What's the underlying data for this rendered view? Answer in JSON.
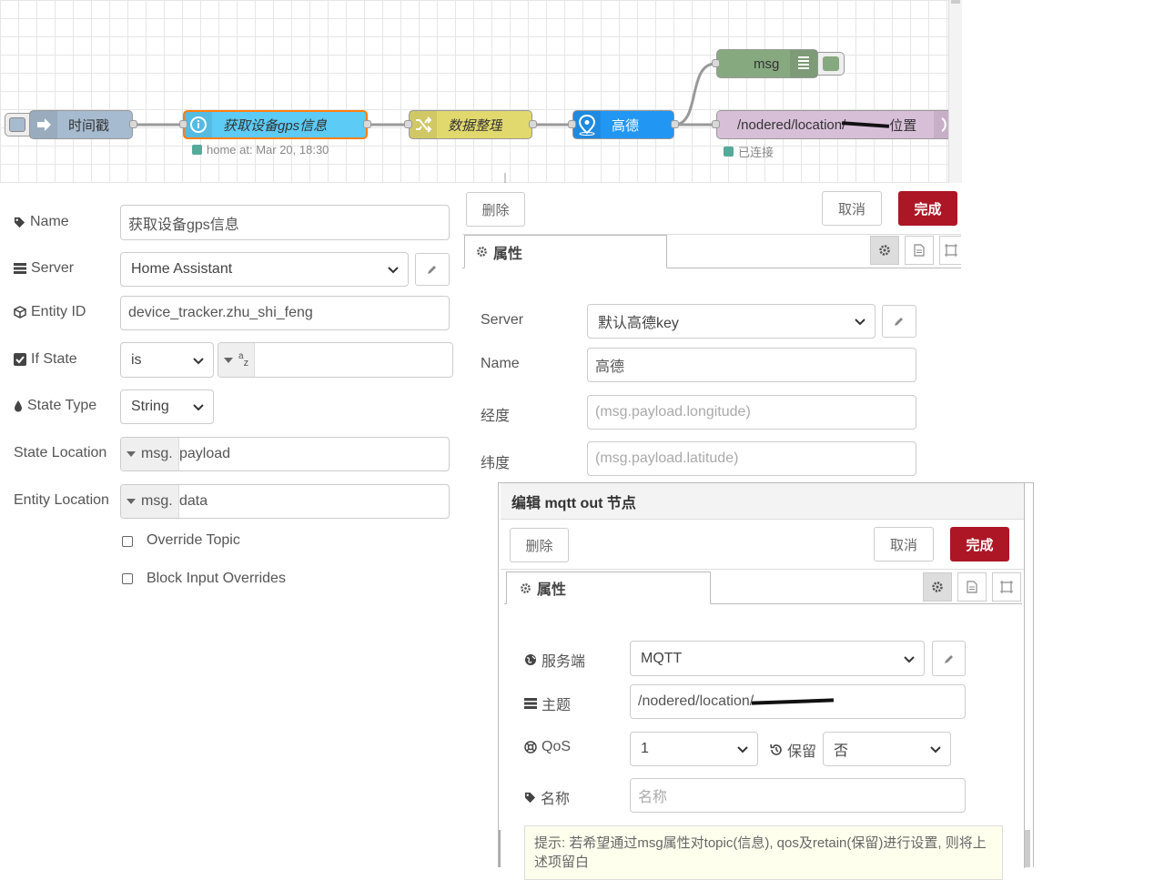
{
  "flow": {
    "nodes": {
      "timestamp": "时间戳",
      "get_gps": "获取设备gps信息",
      "data_clean": "数据整理",
      "gaode": "高德",
      "msg": "msg",
      "mqtt_out": "/nodered/location/",
      "mqtt_out_suffix": "位置"
    },
    "status": {
      "get_gps": "home at: Mar 20, 18:30",
      "mqtt_out": "已连接"
    },
    "colors": {
      "inject": "#a6bbcf",
      "ha": "#5ccbf6",
      "change": "#e2d96e",
      "gaode": "#2196f3",
      "debug": "#87a980",
      "mqtt": "#d8bfd8"
    }
  },
  "ha_panel": {
    "name_label": "Name",
    "name_value": "获取设备gps信息",
    "server_label": "Server",
    "server_value": "Home Assistant",
    "entity_label": "Entity ID",
    "entity_value": "device_tracker.zhu_shi_feng",
    "ifstate_label": "If State",
    "ifstate_op": "is",
    "ifstate_type": "az",
    "statetype_label": "State Type",
    "statetype_value": "String",
    "stateloc_label": "State Location",
    "stateloc_prefix": "msg.",
    "stateloc_value": "payload",
    "entityloc_label": "Entity Location",
    "entityloc_prefix": "msg.",
    "entityloc_value": "data",
    "override_topic": "Override Topic",
    "block_input": "Block Input Overrides"
  },
  "gaode_panel": {
    "delete": "删除",
    "cancel": "取消",
    "done": "完成",
    "tab": "属性",
    "server_label": "Server",
    "server_value": "默认高德key",
    "name_label": "Name",
    "name_value": "高德",
    "lng_label": "经度",
    "lng_placeholder": "(msg.payload.longitude)",
    "lat_label": "纬度",
    "lat_placeholder": "(msg.payload.latitude)"
  },
  "mqtt_panel": {
    "title": "编辑 mqtt out 节点",
    "delete": "删除",
    "cancel": "取消",
    "done": "完成",
    "tab": "属性",
    "broker_label": "服务端",
    "broker_value": "MQTT",
    "topic_label": "主题",
    "topic_value": "/nodered/location/",
    "qos_label": "QoS",
    "qos_value": "1",
    "retain_label": "保留",
    "retain_value": "否",
    "name_label": "名称",
    "name_placeholder": "名称",
    "tip": "提示: 若希望通过msg属性对topic(信息), qos及retain(保留)进行设置, 则将上述项留白"
  }
}
